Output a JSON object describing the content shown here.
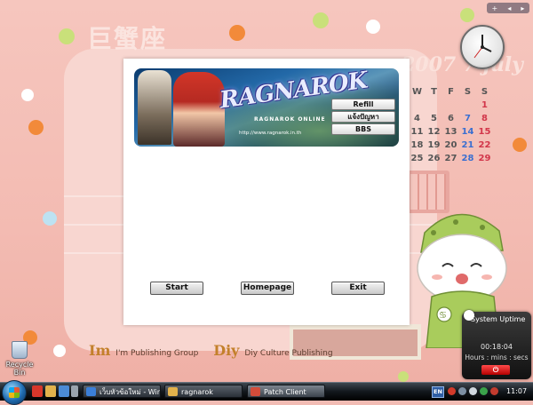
{
  "wallpaper": {
    "title": "巨蟹座",
    "date_text": "2007 7 july",
    "calendar": {
      "headers": [
        "W",
        "T",
        "F",
        "S",
        "S"
      ],
      "rows": [
        [
          "",
          "",
          "",
          "",
          "1"
        ],
        [
          "4",
          "5",
          "6",
          "7",
          "8"
        ],
        [
          "11",
          "12",
          "13",
          "14",
          "15"
        ],
        [
          "18",
          "19",
          "20",
          "21",
          "22"
        ],
        [
          "25",
          "26",
          "27",
          "28",
          "29"
        ]
      ]
    },
    "publisher_1_logo": "Im",
    "publisher_1_name": "I'm Publishing Group",
    "publisher_2_logo": "Diy",
    "publisher_2_name": "Diy Culture Publishing"
  },
  "gadget_controls": [
    "+",
    "◂",
    "▸"
  ],
  "uptime": {
    "title": "System Uptime",
    "value": "00:18:04",
    "label": "Hours : mins : secs",
    "button": "⏻"
  },
  "desktop": {
    "recycle_bin": "Recycle Bin"
  },
  "launcher": {
    "banner": {
      "logo": "RAGNAROK",
      "subtitle": "RAGNAROK ONLINE",
      "url": "http://www.ragnarok.in.th"
    },
    "banner_buttons": [
      "Refill",
      "แจ้งปัญหา",
      "BBS"
    ],
    "buttons": {
      "start": "Start",
      "homepage": "Homepage",
      "exit": "Exit"
    }
  },
  "taskbar": {
    "tasks": [
      {
        "label": "เว็บหัวข้อใหม่ - Wind...",
        "icon_color": "#3b7fd8",
        "active": false
      },
      {
        "label": "ragnarok",
        "icon_color": "#e2b24c",
        "active": false
      },
      {
        "label": "Patch Client",
        "icon_color": "#d24c3a",
        "active": true
      }
    ],
    "language": "EN",
    "clock": "11:07"
  },
  "colors": {
    "wallpaper_pink": "#f3bbb2",
    "launcher_bg": "#ffffff",
    "taskbar_bg": "#12171c"
  }
}
